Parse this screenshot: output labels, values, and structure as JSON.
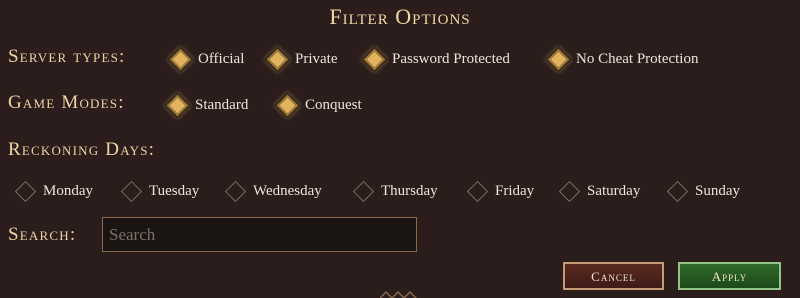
{
  "dialog": {
    "title": "Filter Options",
    "server_types": {
      "label": "Server types:",
      "options": [
        {
          "label": "Official",
          "checked": true
        },
        {
          "label": "Private",
          "checked": true
        },
        {
          "label": "Password Protected",
          "checked": true
        },
        {
          "label": "No Cheat Protection",
          "checked": true
        }
      ]
    },
    "game_modes": {
      "label": "Game Modes:",
      "options": [
        {
          "label": "Standard",
          "checked": true
        },
        {
          "label": "Conquest",
          "checked": true
        }
      ]
    },
    "reckoning_days": {
      "label": "Reckoning Days:",
      "options": [
        {
          "label": "Monday",
          "checked": false
        },
        {
          "label": "Tuesday",
          "checked": false
        },
        {
          "label": "Wednesday",
          "checked": false
        },
        {
          "label": "Thursday",
          "checked": false
        },
        {
          "label": "Friday",
          "checked": false
        },
        {
          "label": "Saturday",
          "checked": false
        },
        {
          "label": "Sunday",
          "checked": false
        }
      ]
    },
    "search": {
      "label": "Search:",
      "placeholder": "Search",
      "value": ""
    },
    "buttons": {
      "cancel": "Cancel",
      "apply": "Apply"
    }
  },
  "colors": {
    "background": "#2a1d1b",
    "accent_gold": "#e2b35f",
    "cancel_button": "#4a211b",
    "apply_button": "#276022"
  }
}
